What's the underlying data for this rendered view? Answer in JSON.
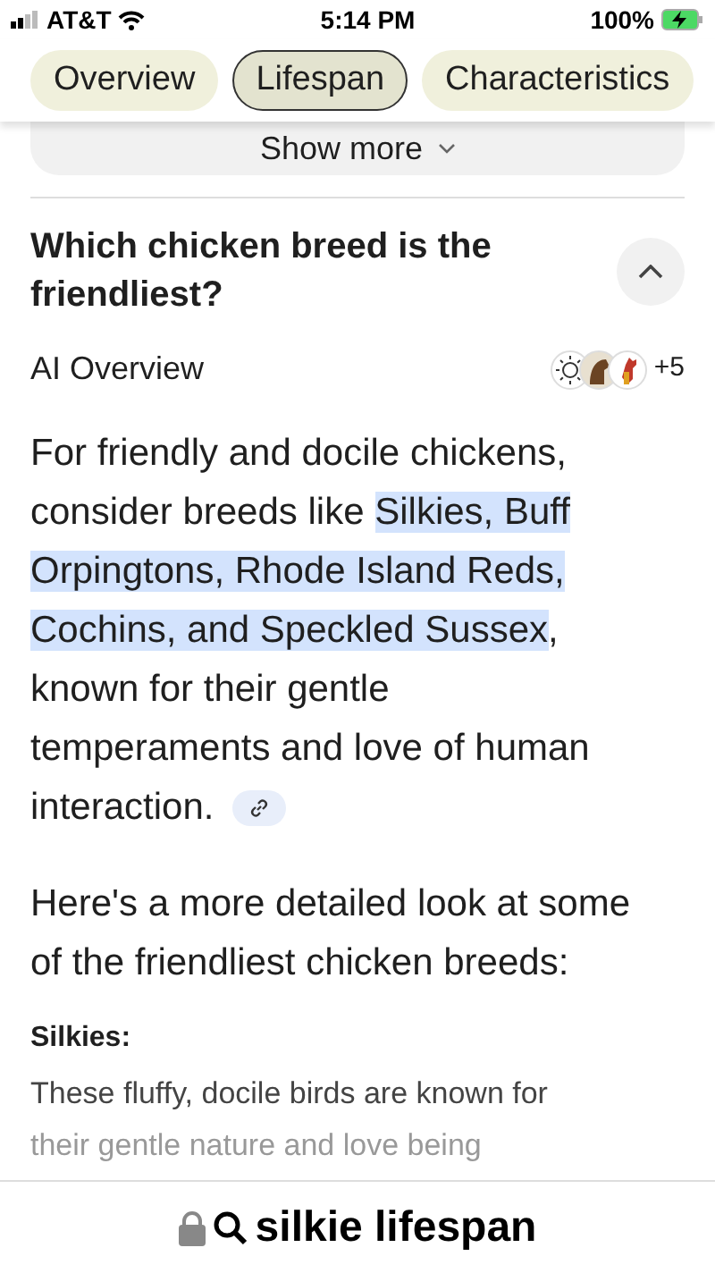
{
  "status_bar": {
    "carrier": "AT&T",
    "time": "5:14 PM",
    "battery": "100%"
  },
  "tabs": [
    {
      "label": "Overview",
      "selected": false
    },
    {
      "label": "Lifespan",
      "selected": true
    },
    {
      "label": "Characteristics",
      "selected": false
    }
  ],
  "show_more": {
    "label": "Show more"
  },
  "question": {
    "title": "Which chicken breed is the friendliest?",
    "expanded": true
  },
  "ai_overview": {
    "label": "AI Overview",
    "sources_more": "+5"
  },
  "answer": [
    {
      "text": "For friendly and docile chickens, consider breeds like ",
      "highlighted": false
    },
    {
      "text": "Silkies, Buff Orpingtons, Rhode Island Reds, Cochins, and Speckled Sussex",
      "highlighted": true
    },
    {
      "text": ", known for their gentle temperaments and love of human interaction.",
      "highlighted": false
    }
  ],
  "intro": "Here's a more detailed look at some of the friendliest chicken breeds:",
  "section": {
    "heading": "Silkies:",
    "lines": [
      "These fluffy, docile birds are known for",
      "their gentle nature and love being"
    ]
  },
  "address_bar": {
    "query": "silkie lifespan"
  }
}
